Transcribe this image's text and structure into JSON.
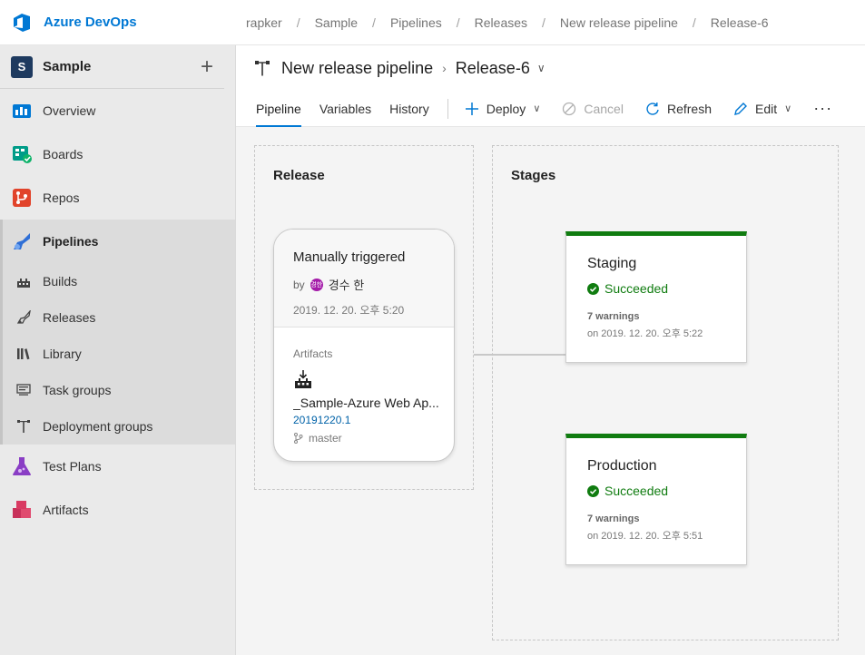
{
  "app": {
    "name": "Azure DevOps",
    "accent": "#0078d4"
  },
  "breadcrumb": [
    "rapker",
    "Sample",
    "Pipelines",
    "Releases",
    "New release pipeline",
    "Release-6"
  ],
  "project": {
    "initial": "S",
    "name": "Sample",
    "add_label": "+"
  },
  "nav": {
    "overview": "Overview",
    "boards": "Boards",
    "repos": "Repos",
    "pipelines": "Pipelines",
    "builds": "Builds",
    "releases": "Releases",
    "library": "Library",
    "task_groups": "Task groups",
    "deployment_groups": "Deployment groups",
    "test_plans": "Test Plans",
    "artifacts": "Artifacts"
  },
  "header": {
    "pipeline_name": "New release pipeline",
    "release_name": "Release-6"
  },
  "tabs": {
    "pipeline": "Pipeline",
    "variables": "Variables",
    "history": "History"
  },
  "toolbar": {
    "deploy": "Deploy",
    "cancel": "Cancel",
    "refresh": "Refresh",
    "edit": "Edit",
    "more": "···"
  },
  "release": {
    "title": "Release",
    "trigger": "Manually triggered",
    "by_label": "by",
    "avatar_initials": "경한",
    "user": "경수 한",
    "date": "2019. 12. 20. 오후 5:20",
    "artifacts_label": "Artifacts",
    "artifact_name": "_Sample-Azure Web Ap...",
    "artifact_version": "20191220.1",
    "branch": "master"
  },
  "stages": {
    "title": "Stages",
    "items": [
      {
        "name": "Staging",
        "status": "Succeeded",
        "warnings": "7 warnings",
        "date": "on 2019. 12. 20. 오후 5:22"
      },
      {
        "name": "Production",
        "status": "Succeeded",
        "warnings": "7 warnings",
        "date": "on 2019. 12. 20. 오후 5:51"
      }
    ],
    "success_color": "#107c10"
  }
}
